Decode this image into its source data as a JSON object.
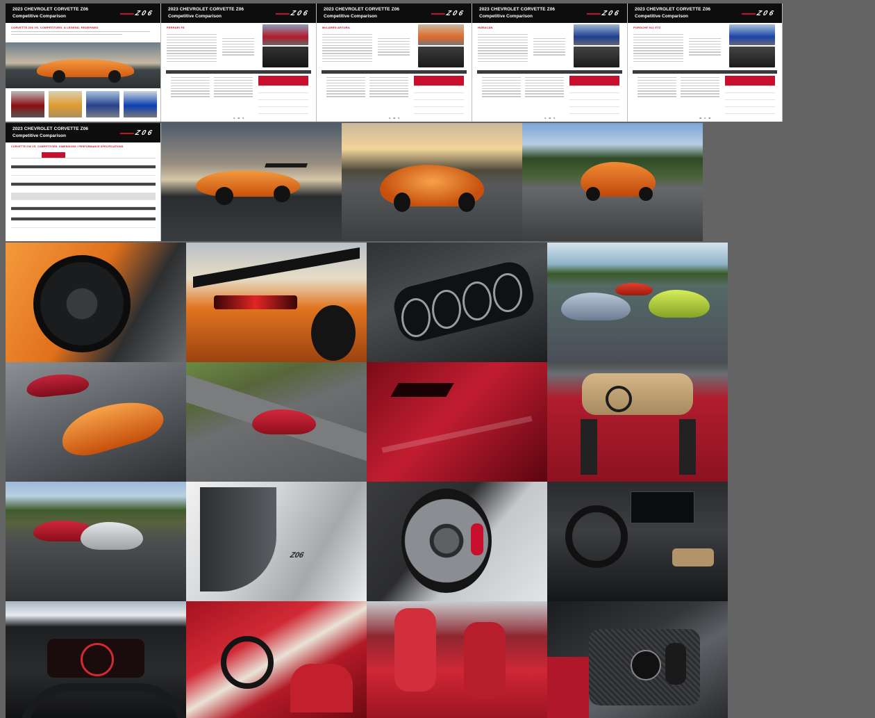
{
  "brochure": {
    "title_line1": "2023 CHEVROLET CORVETTE Z06",
    "title_line2": "Competitive Comparison",
    "logo": "Z06",
    "sections": {
      "cover": "CORVETTE Z06 VS. COMPETITORS: A LEGEND, REDEFINED",
      "spec_table": "CORVETTE Z06 VS. COMPETITORS: DIMENSIONS / PERFORMANCE SPECIFICATIONS"
    },
    "pages": [
      {
        "id": "page-cover",
        "section": "CORVETTE Z06 VS. COMPETITORS: A LEGEND, REDEFINED"
      },
      {
        "id": "page-ferrari",
        "section": "FERRARI F8"
      },
      {
        "id": "page-mclaren",
        "section": "McLAREN ARTURA"
      },
      {
        "id": "page-lambo",
        "section": "HURACÁN"
      },
      {
        "id": "page-porsche",
        "section": "PORSCHE 911 GT3"
      },
      {
        "id": "page-specs",
        "section": "CORVETTE Z06 VS. COMPETITORS: DIMENSIONS / PERFORMANCE SPECIFICATIONS"
      }
    ]
  },
  "colors": {
    "background": "#646464",
    "header": "#0d0d0d",
    "accent_red": "#c8102e",
    "corvette_orange": "#e8701c",
    "corvette_red": "#b0182a"
  },
  "photos": [
    {
      "name": "orange-coupe-rear-sunset"
    },
    {
      "name": "orange-coupe-front"
    },
    {
      "name": "orange-coupe-track-rear"
    },
    {
      "name": "orange-wheel-closeup"
    },
    {
      "name": "orange-rear-wing"
    },
    {
      "name": "quad-exhaust-closeup"
    },
    {
      "name": "three-cars-track"
    },
    {
      "name": "red-and-orange-convertibles"
    },
    {
      "name": "red-convertible-track"
    },
    {
      "name": "red-side-intake"
    },
    {
      "name": "red-convertible-overhead-interior"
    },
    {
      "name": "red-and-silver-track"
    },
    {
      "name": "silver-z06-badge"
    },
    {
      "name": "silver-wheel-red-caliper"
    },
    {
      "name": "dashboard-steering-wheel"
    },
    {
      "name": "gauge-cluster-view"
    },
    {
      "name": "red-interior-cabin"
    },
    {
      "name": "red-seats"
    },
    {
      "name": "carbon-center-console"
    }
  ]
}
